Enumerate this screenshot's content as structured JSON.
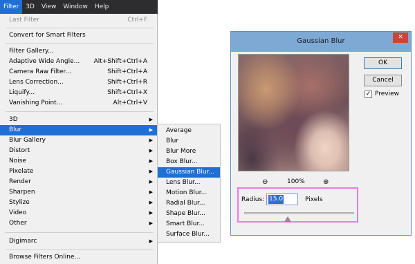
{
  "menubar": {
    "items": [
      "Filter",
      "3D",
      "View",
      "Window",
      "Help"
    ]
  },
  "filter_menu": {
    "last_filter": {
      "label": "Last Filter",
      "shortcut": "Ctrl+F"
    },
    "convert": {
      "label": "Convert for Smart Filters"
    },
    "gallery": [
      {
        "label": "Filter Gallery...",
        "shortcut": ""
      },
      {
        "label": "Adaptive Wide Angle...",
        "shortcut": "Alt+Shift+Ctrl+A"
      },
      {
        "label": "Camera Raw Filter...",
        "shortcut": "Shift+Ctrl+A"
      },
      {
        "label": "Lens Correction...",
        "shortcut": "Shift+Ctrl+R"
      },
      {
        "label": "Liquify...",
        "shortcut": "Shift+Ctrl+X"
      },
      {
        "label": "Vanishing Point...",
        "shortcut": "Alt+Ctrl+V"
      }
    ],
    "groups": [
      "3D",
      "Blur",
      "Blur Gallery",
      "Distort",
      "Noise",
      "Pixelate",
      "Render",
      "Sharpen",
      "Stylize",
      "Video",
      "Other"
    ],
    "digimarc": "Digimarc",
    "browse": "Browse Filters Online..."
  },
  "blur_submenu": [
    "Average",
    "Blur",
    "Blur More",
    "Box Blur...",
    "Gaussian Blur...",
    "Lens Blur...",
    "Motion Blur...",
    "Radial Blur...",
    "Shape Blur...",
    "Smart Blur...",
    "Surface Blur..."
  ],
  "dialog": {
    "title": "Gaussian Blur",
    "close": "✕",
    "ok": "OK",
    "cancel": "Cancel",
    "preview_label": "Preview",
    "preview_checked": true,
    "zoom_out_icon": "⊖",
    "zoom_level": "100%",
    "zoom_in_icon": "⊕",
    "radius_label": "Radius:",
    "radius_value": "15.0",
    "radius_unit": "Pixels"
  }
}
